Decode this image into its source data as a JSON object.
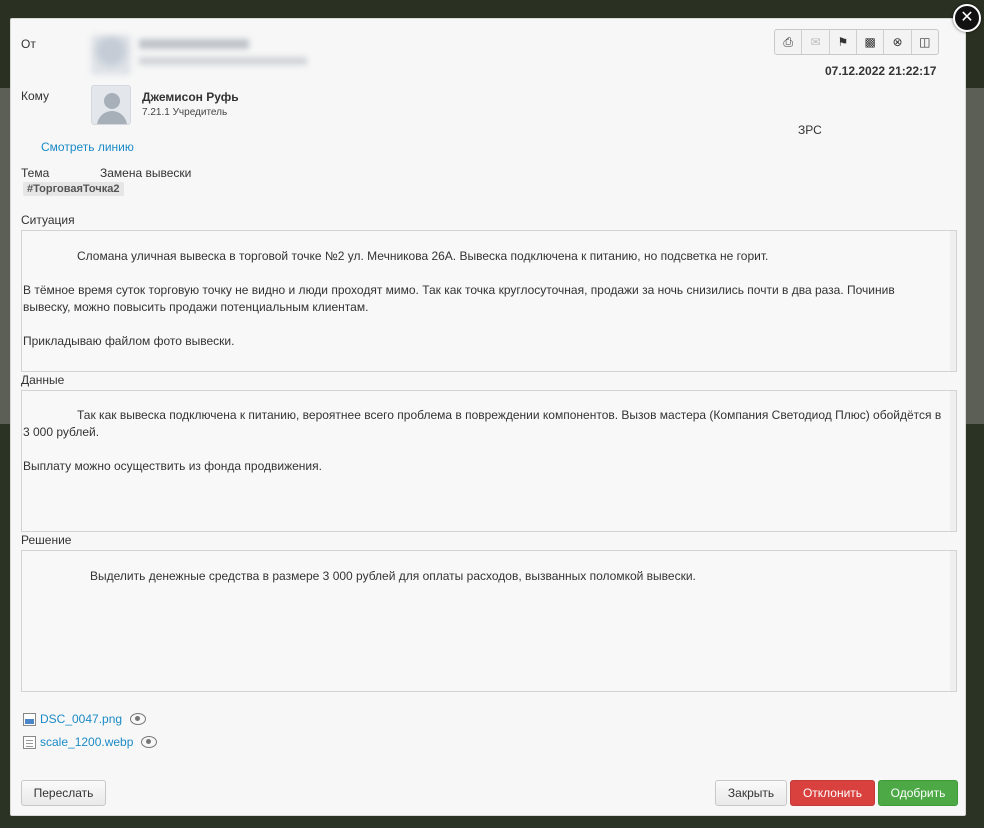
{
  "header": {
    "from_label": "От",
    "to_label": "Кому",
    "recipient_name": "Джемисон Руфь",
    "recipient_role": "7.21.1 Учредитель",
    "view_line_link": "Смотреть линию",
    "date": "07.12.2022 21:22:17",
    "code": "ЗРС"
  },
  "toolbar": {
    "icons": [
      "print-icon",
      "email-icon",
      "tag-icon",
      "briefcase-icon",
      "cancel-icon",
      "trash-icon"
    ]
  },
  "subject": {
    "label": "Тема",
    "value": "Замена вывески",
    "tag": "#ТорговаяТочка2"
  },
  "situation": {
    "label": "Ситуация",
    "p1": "Сломана уличная вывеска в торговой точке №2  ул. Мечникова 26А. Вывеска подключена к питанию, но подсветка не горит.",
    "p2": "В тёмное время суток торговую точку не видно и люди проходят мимо. Так как точка круглосуточная, продажи за ночь снизились почти в два раза. Починив вывеску, можно повысить продажи потенциальным клиентам.",
    "p3": "Прикладываю файлом фото вывески."
  },
  "data_section": {
    "label": "Данные",
    "p1": "Так как вывеска подключена к питанию, вероятнее всего проблема в повреждении компонентов. Вызов мастера (Компания Светодиод Плюс) обойдётся в 3 000 рублей.",
    "p2": "Выплату можно осуществить из фонда продвижения."
  },
  "solution": {
    "label": "Решение",
    "p1": "Выделить денежные средства в размере 3 000 рублей для оплаты расходов, вызванных поломкой вывески."
  },
  "attachments": [
    {
      "name": "DSC_0047.png"
    },
    {
      "name": "scale_1200.webp"
    }
  ],
  "buttons": {
    "forward": "Переслать",
    "close": "Закрыть",
    "reject": "Отклонить",
    "approve": "Одобрить"
  },
  "colors": {
    "link": "#1a8ac6",
    "reject": "#d9413f",
    "approve": "#4ca945"
  }
}
